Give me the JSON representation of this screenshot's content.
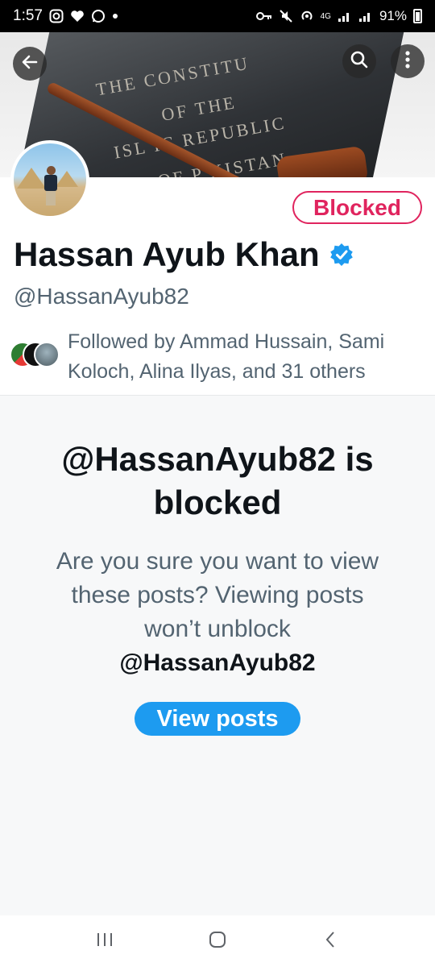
{
  "status_bar": {
    "time": "1:57",
    "battery": "91%",
    "network": "4G"
  },
  "header": {
    "back_icon": "back-arrow-icon",
    "search_icon": "search-icon",
    "more_icon": "more-vertical-icon",
    "banner_lines": [
      "THE CONSTITU",
      "OF THE",
      "ISL  IC REPUBLIC",
      "OF P  KISTAN"
    ]
  },
  "profile": {
    "status_label": "Blocked",
    "name": "Hassan Ayub Khan",
    "verified": true,
    "handle": "@HassanAyub82",
    "followed_by_text": "Followed by Ammad Hussain, Sami Koloch, Alina Ilyas, and 31 others"
  },
  "blocked_notice": {
    "title": "@HassanAyub82 is blocked",
    "description": "Are you sure you want to view these posts? Viewing posts won’t unblock",
    "handle": "@HassanAyub82",
    "button_label": "View posts"
  },
  "colors": {
    "accent": "#1d9bf0",
    "blocked": "#e0245e",
    "text_secondary": "#536471"
  }
}
